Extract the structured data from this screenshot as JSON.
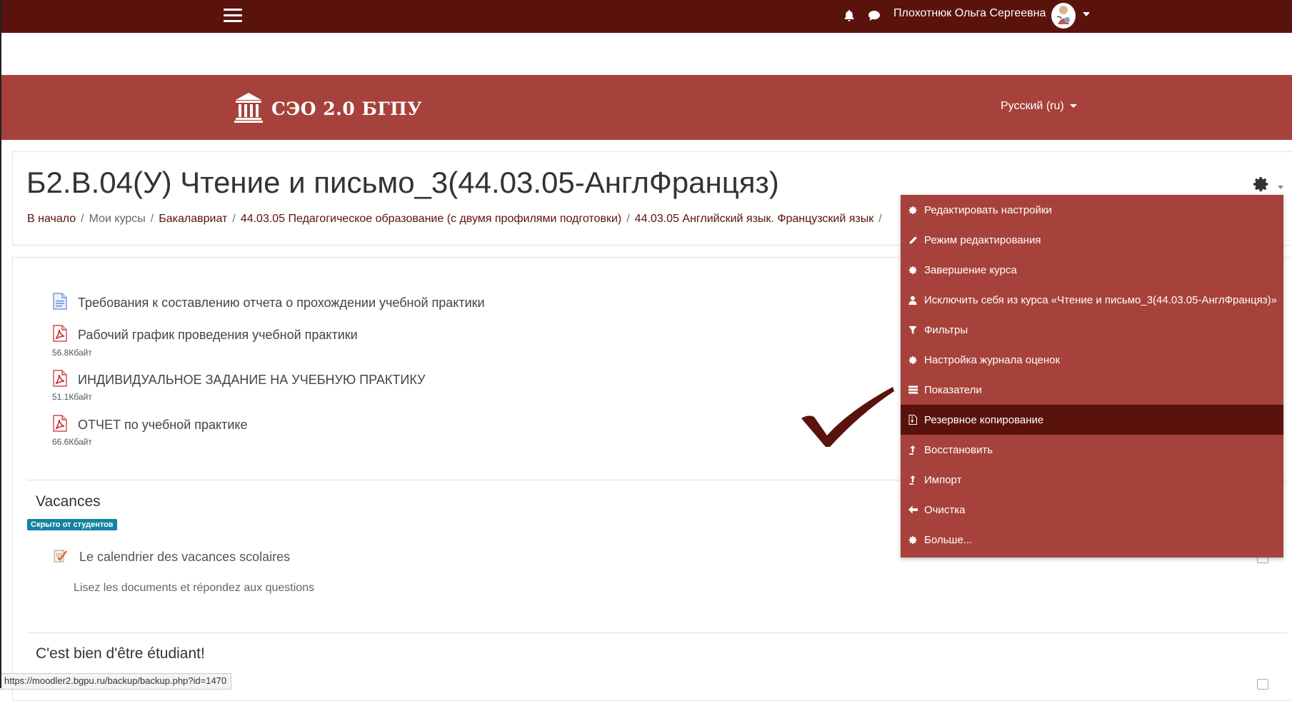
{
  "topbar": {
    "username": "Плохотнюк Ольга Сергеевна"
  },
  "header": {
    "brand": "СЭО 2.0 БГПУ",
    "language": "Русский ‎(ru)‎"
  },
  "page": {
    "title": "Б2.В.04(У) Чтение и письмо_3(44.03.05-АнглФранцяз)",
    "breadcrumb": [
      "В начало",
      "Мои курсы",
      "Бакалавриат",
      "44.03.05 Педагогическое образование (с двумя профилями подготовки)",
      "44.03.05 Английский язык. Французский язык"
    ]
  },
  "activities": [
    {
      "name": "Требования к составлению отчета о прохождении учебной практики",
      "icon": "page-icon",
      "size": ""
    },
    {
      "name": "Рабочий график проведения учебной практики",
      "icon": "pdf-icon",
      "size": "56.8Кбайт"
    },
    {
      "name": "ИНДИВИДУАЛЬНОЕ ЗАДАНИЕ НА УЧЕБНУЮ ПРАКТИКУ",
      "icon": "pdf-icon",
      "size": "51.1Кбайт"
    },
    {
      "name": "ОТЧЕТ по учебной практике",
      "icon": "pdf-icon",
      "size": "66.6Кбайт"
    }
  ],
  "sections": [
    {
      "title": "Vacances",
      "badge": "Скрыто от студентов",
      "activity": "Le calendrier des vacances scolaires",
      "description": "Lisez les documents et répondez aux questions"
    },
    {
      "title": "C'est bien d'être étudiant!"
    }
  ],
  "menu": {
    "items": [
      {
        "label": "Редактировать настройки",
        "icon": "gear-icon"
      },
      {
        "label": "Режим редактирования",
        "icon": "pencil-icon"
      },
      {
        "label": "Завершение курса",
        "icon": "gear-icon"
      },
      {
        "label": "Исключить себя из курса «Чтение и письмо_3(44.03.05-АнглФранцяз)»",
        "icon": "user-icon"
      },
      {
        "label": "Фильтры",
        "icon": "filter-icon"
      },
      {
        "label": "Настройка журнала оценок",
        "icon": "gear-icon"
      },
      {
        "label": "Показатели",
        "icon": "list-icon"
      },
      {
        "label": "Резервное копирование",
        "icon": "file-archive-icon",
        "active": true
      },
      {
        "label": "Восстановить",
        "icon": "upload-icon"
      },
      {
        "label": "Импорт",
        "icon": "upload-icon"
      },
      {
        "label": "Очистка",
        "icon": "arrow-left-icon"
      },
      {
        "label": "Больше...",
        "icon": "gear-icon"
      }
    ]
  },
  "statusbar": {
    "url": "https://moodler2.bgpu.ru/backup/backup.php?id=1470"
  },
  "colors": {
    "topbar": "#5a120d",
    "header": "#a6423b",
    "badge": "#1283a1"
  }
}
